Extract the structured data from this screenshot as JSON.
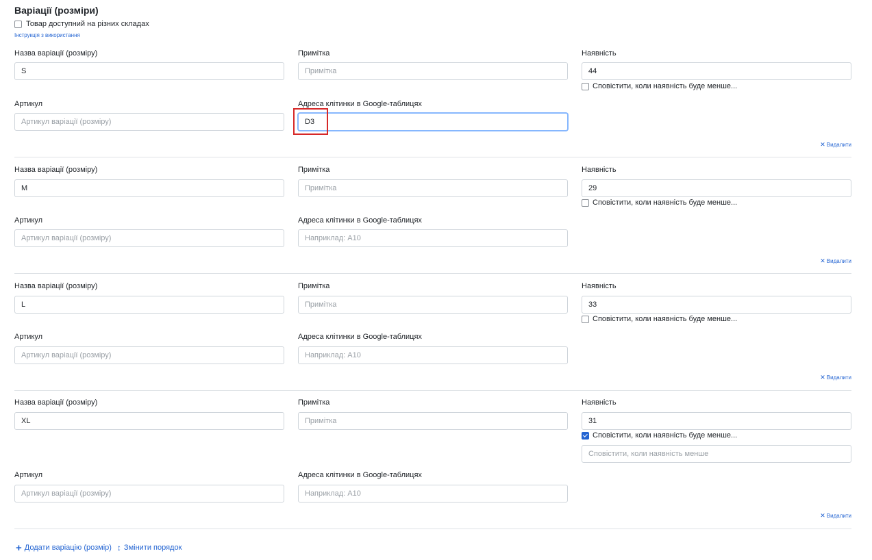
{
  "section": {
    "title": "Варіації (розміри)",
    "multi_warehouse_label": "Товар доступний на різних складах",
    "multi_warehouse_checked": false,
    "help_link": "Інструкція з використання"
  },
  "labels": {
    "name": "Назва варіації (розміру)",
    "note": "Примітка",
    "stock": "Наявність",
    "sku": "Артикул",
    "cell": "Адреса клітинки в Google-таблицях",
    "notify": "Сповістити, коли наявність буде менше...",
    "remove": "Видалити"
  },
  "placeholders": {
    "note": "Примітка",
    "sku": "Артикул варіації (розміру)",
    "cell": "Наприклад: A10",
    "notify_threshold": "Сповістити, коли наявність менше"
  },
  "variations": [
    {
      "name": "S",
      "stock": "44",
      "cell": "D3",
      "notify": false
    },
    {
      "name": "M",
      "stock": "29",
      "cell": "",
      "notify": false
    },
    {
      "name": "L",
      "stock": "33",
      "cell": "",
      "notify": false
    },
    {
      "name": "XL",
      "stock": "31",
      "cell": "",
      "notify": true
    }
  ],
  "footer": {
    "add_label": "Додати варіацію (розмір)",
    "reorder_label": "Змінити порядок"
  },
  "colors": {
    "accent": "#2364d2",
    "highlight": "#d62828"
  }
}
